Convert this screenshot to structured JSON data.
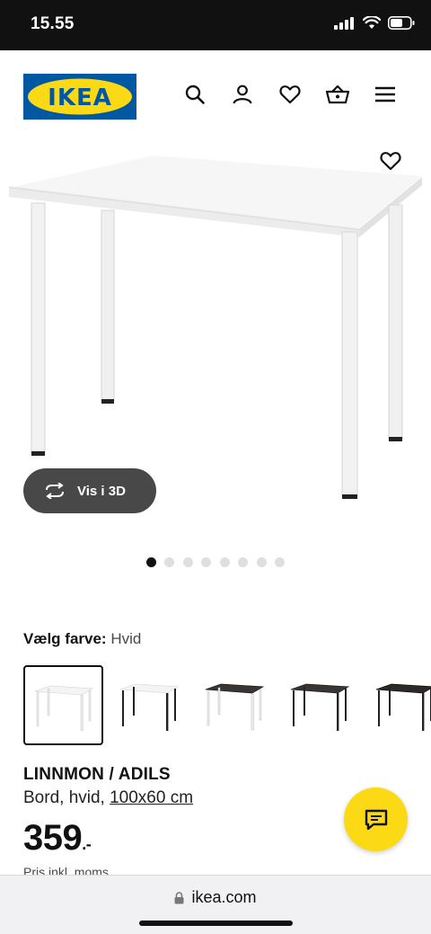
{
  "status": {
    "time": "15.55"
  },
  "brand": {
    "logo_text": "IKEA",
    "blue": "#0058a3",
    "yellow": "#fbd914"
  },
  "nav": {
    "icons": [
      "search-icon",
      "user-icon",
      "heart-icon",
      "basket-icon",
      "menu-icon"
    ]
  },
  "gallery": {
    "view3d_label": "Vis i 3D",
    "dot_count": 8,
    "active_dot": 0
  },
  "color_selector": {
    "label": "Vælg farve:",
    "selected_value": "Hvid",
    "swatches": [
      {
        "top": "white",
        "legs": "white",
        "selected": true
      },
      {
        "top": "white",
        "legs": "black",
        "selected": false
      },
      {
        "top": "black-brown",
        "legs": "white",
        "selected": false
      },
      {
        "top": "black-brown",
        "legs": "black",
        "selected": false
      },
      {
        "top": "black-brown",
        "legs": "black",
        "selected": false
      }
    ]
  },
  "product": {
    "name": "LINNMON / ADILS",
    "description_prefix": "Bord, hvid, ",
    "dimensions": "100x60 cm",
    "price": "359",
    "price_suffix": ".-",
    "price_note": "Pris inkl. moms"
  },
  "browser": {
    "url": "ikea.com"
  }
}
